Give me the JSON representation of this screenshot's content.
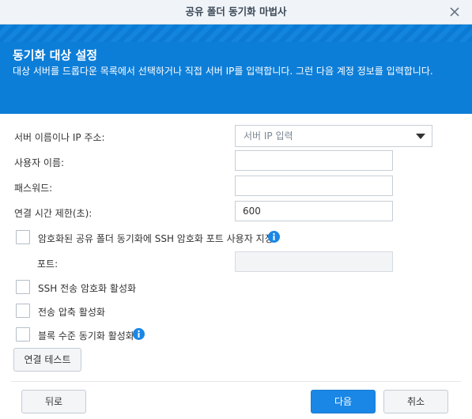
{
  "window": {
    "title": "공유 폴더 동기화 마법사"
  },
  "banner": {
    "heading": "동기화 대상 설정",
    "description": "대상 서버를 드롭다운 목록에서 선택하거나 직접 서버 IP를 입력합니다. 그런 다음 계정 정보를 입력합니다."
  },
  "form": {
    "server_label": "서버 이름이나 IP 주소:",
    "server_placeholder": "서버 IP 입력",
    "username_label": "사용자 이름:",
    "username_value": "",
    "password_label": "패스워드:",
    "password_value": "",
    "timeout_label": "연결 시간 제한(초):",
    "timeout_value": "600",
    "ssh_port_check_label": "암호화된 공유 폴더 동기화에 SSH 암호화 포트 사용자 지정",
    "port_label": "포트:",
    "port_value": "",
    "ssh_encrypt_label": "SSH 전송 암호화 활성화",
    "compress_label": "전송 압축 활성화",
    "block_sync_label": "블록 수준 동기화 활성화",
    "test_button": "연결 테스트"
  },
  "footer": {
    "back": "뒤로",
    "next": "다음",
    "cancel": "취소"
  },
  "colors": {
    "banner": "#0d7ed8",
    "primary_button": "#1a87e6",
    "info_icon": "#1a87e6"
  }
}
